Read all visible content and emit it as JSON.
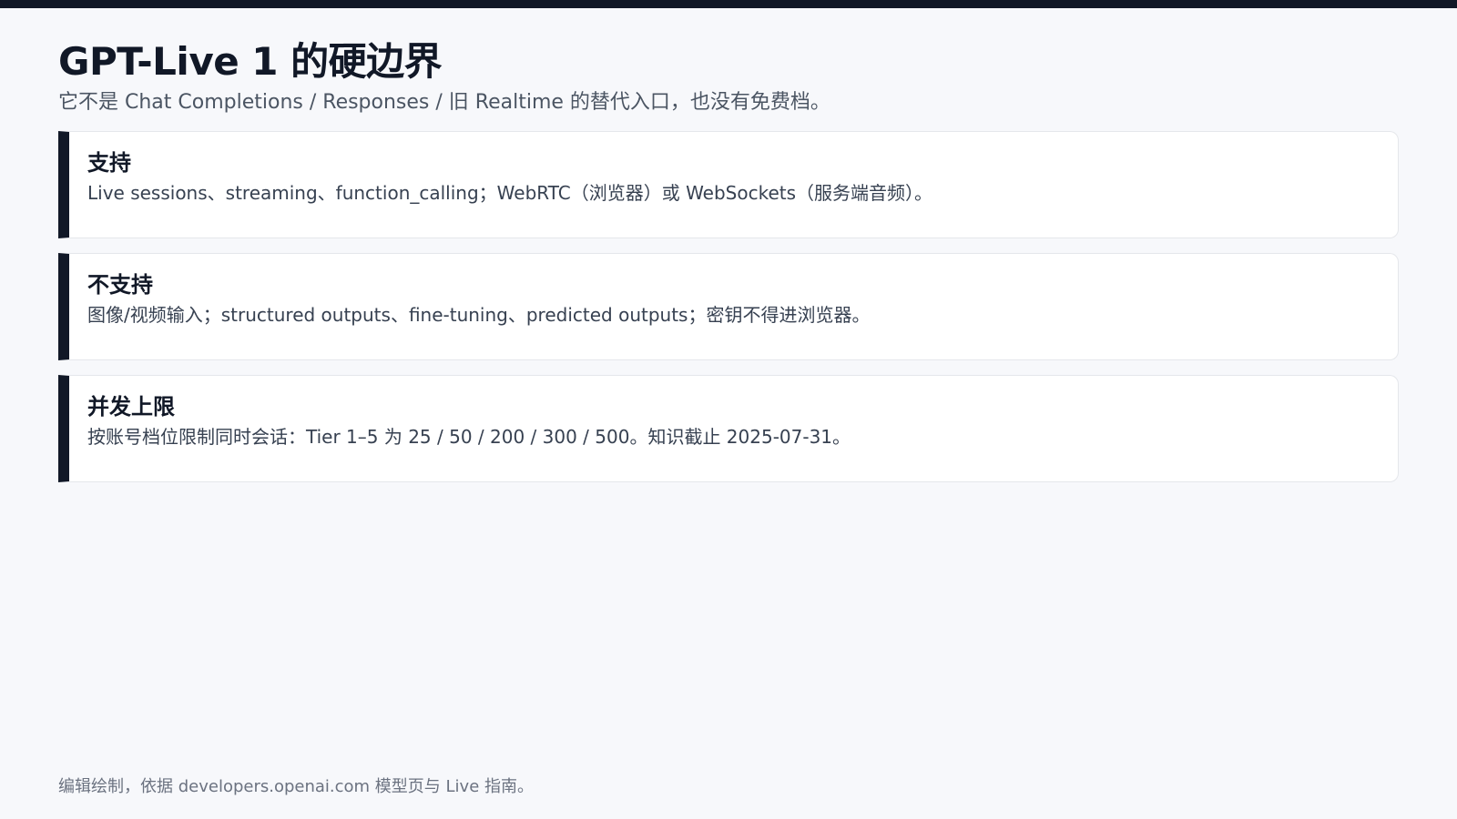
{
  "slide": {
    "title": "GPT-Live 1 的硬边界",
    "subtitle": "它不是 Chat Completions / Responses / 旧 Realtime 的替代入口，也没有免费档。",
    "cards": [
      {
        "title": "支持",
        "text": "Live sessions、streaming、function_calling；WebRTC（浏览器）或 WebSockets（服务端音频）。"
      },
      {
        "title": "不支持",
        "text": "图像/视频输入；structured outputs、fine-tuning、predicted outputs；密钥不得进浏览器。"
      },
      {
        "title": "并发上限",
        "text": "按账号档位限制同时会话：Tier 1–5 为 25 / 50 / 200 / 300 / 500。知识截止 2025-07-31。"
      }
    ],
    "footer": "编辑绘制，依据 developers.openai.com 模型页与 Live 指南。"
  },
  "theme": {
    "background": "#f7f8fb",
    "accent": "#111827",
    "card_background": "#ffffff",
    "border": "#e5e7eb",
    "muted_text": "#4b5563"
  }
}
